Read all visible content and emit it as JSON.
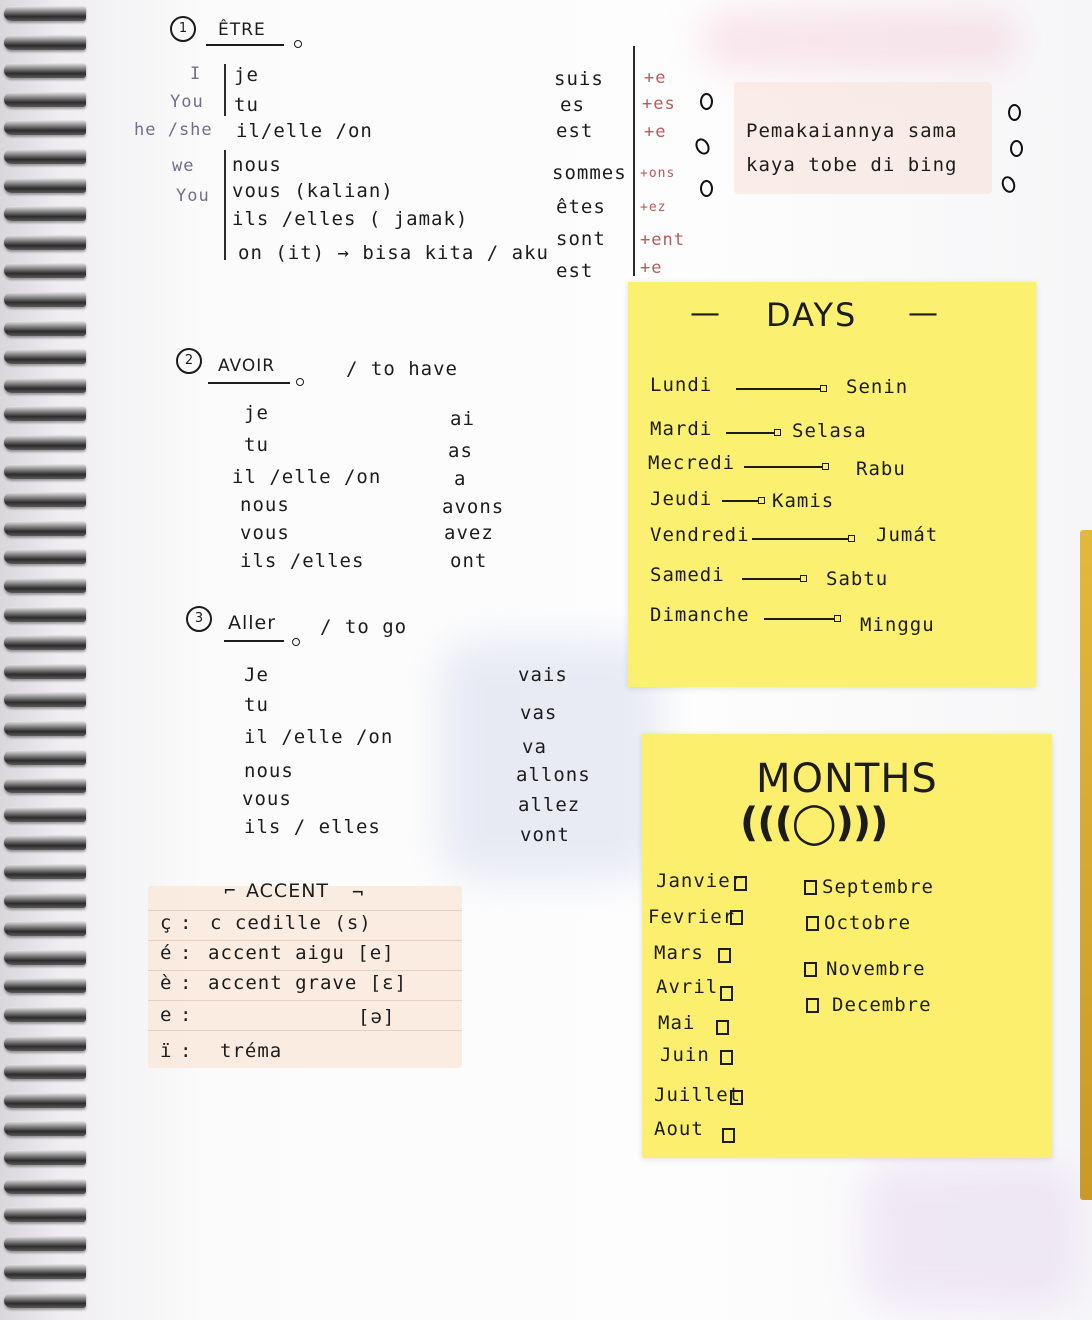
{
  "etre": {
    "number": "1",
    "title": "ÊTRE",
    "pronoun_en": [
      "I",
      "You",
      "he /she",
      "we",
      "You"
    ],
    "pronoun_fr": [
      "je",
      "tu",
      "il/elle /on",
      "nous",
      "vous (kalian)",
      "ils /elles ( jamak)",
      "on (it) → bisa kita / aku"
    ],
    "forms": [
      "suis",
      "es",
      "est",
      "sommes",
      "êtes",
      "sont",
      "est"
    ],
    "endings": [
      "+e",
      "+es",
      "+e",
      "+ons",
      "+ez",
      "+ent",
      "+e"
    ],
    "note": [
      "Pemakaiannya sama",
      "kaya tobe di bing"
    ]
  },
  "avoir": {
    "number": "2",
    "title": "AVOIR",
    "meaning": "/ to have",
    "pronouns": [
      "je",
      "tu",
      "il /elle /on",
      "nous",
      "vous",
      "ils /elles"
    ],
    "forms": [
      "ai",
      "as",
      "a",
      "avons",
      "avez",
      "ont"
    ]
  },
  "aller": {
    "number": "3",
    "title": "Aller",
    "meaning": "/ to go",
    "pronouns": [
      "Je",
      "tu",
      "il /elle /on",
      "nous",
      "vous",
      "ils / elles"
    ],
    "forms": [
      "vais",
      "vas",
      "va",
      "allons",
      "allez",
      "vont"
    ]
  },
  "accent": {
    "title": "ACCENT",
    "rows": [
      {
        "mark": "ç",
        "desc": "c cedille (s)"
      },
      {
        "mark": "é",
        "desc": "accent aigu [e]"
      },
      {
        "mark": "è",
        "desc": "accent grave [ɛ]"
      },
      {
        "mark": "e",
        "desc": "[ə]"
      },
      {
        "mark": "ï",
        "desc": "tréma"
      }
    ]
  },
  "days": {
    "title": "DAYS",
    "dash": "—",
    "items": [
      {
        "fr": "Lundi",
        "id": "Senin"
      },
      {
        "fr": "Mardi",
        "id": "Selasa"
      },
      {
        "fr": "Mecredi",
        "id": "Rabu"
      },
      {
        "fr": "Jeudi",
        "id": "Kamis"
      },
      {
        "fr": "Vendredi",
        "id": "Jumát"
      },
      {
        "fr": "Samedi",
        "id": "Sabtu"
      },
      {
        "fr": "Dimanche",
        "id": "Minggu"
      }
    ]
  },
  "months": {
    "title": "MONTHS",
    "moons": "(((◯)))",
    "left": [
      "Janvier",
      "Fevrier",
      "Mars",
      "Avril",
      "Mai",
      "Juin",
      "Juillet",
      "Aout"
    ],
    "right": [
      "Septembre",
      "Octobre",
      "Novembre",
      "Decembre"
    ]
  },
  "colors": {
    "sticky_yellow": "#fbf070",
    "ink": "#1c1c1c",
    "pencil_blue": "#6f6f8c",
    "tape_pink": "#f8e0d6"
  }
}
